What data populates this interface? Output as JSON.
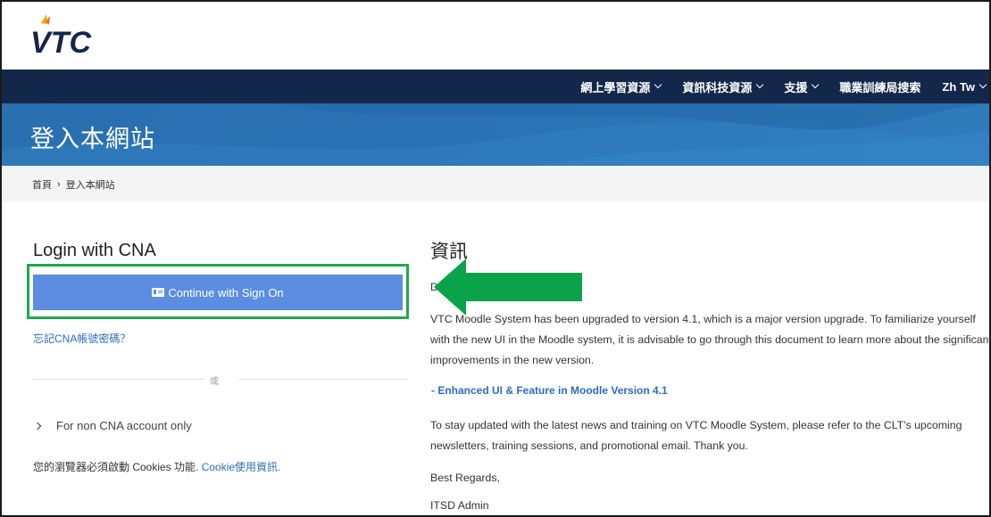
{
  "logo": {
    "text": "VTC"
  },
  "nav": {
    "items": [
      {
        "label": "網上學習資源",
        "has_dropdown": true
      },
      {
        "label": "資訊科技資源",
        "has_dropdown": true
      },
      {
        "label": "支援",
        "has_dropdown": true
      },
      {
        "label": "職業訓練局搜索",
        "has_dropdown": false
      },
      {
        "label": "Zh Tw",
        "has_dropdown": true
      }
    ]
  },
  "banner": {
    "title": "登入本網站"
  },
  "breadcrumb": {
    "home": "首頁",
    "separator": "›",
    "current": "登入本網站"
  },
  "login": {
    "title": "Login with CNA",
    "sso_button": "Continue with Sign On",
    "forgot_link": "忘記CNA帳號密碼？",
    "divider": "或",
    "non_cna": "For non CNA account only",
    "cookies_text": "您的瀏覽器必須啟動 Cookies 功能. ",
    "cookies_link": "Cookie使用資訊."
  },
  "info": {
    "title": "資訊",
    "greeting": "D",
    "paragraph1": "VTC Moodle System has been upgraded to version 4.1, which is a major version upgrade. To familiarize yourself with the new UI in the Moodle system, it is advisable to go through this document to learn more about the significant improvements in the new version.",
    "feature_link": "- Enhanced UI & Feature in Moodle Version 4.1",
    "paragraph2": "To stay updated with the latest news and training on VTC Moodle System, please refer to the CLT's upcoming newsletters, training sessions, and promotional email.  Thank you.",
    "regards": "Best Regards,",
    "signature": "ITSD Admin"
  },
  "colors": {
    "navbar": "#13274a",
    "banner": "#2a6fb0",
    "button": "#5b8ee0",
    "highlight_box": "#1faa4a",
    "arrow": "#0aa34a",
    "link": "#2b6cbf"
  },
  "icons": {
    "logo": "vtc-logo",
    "button": "id-card-icon",
    "dropdown": "chevron-down-icon",
    "expand": "chevron-right-icon",
    "annotation": "green-arrow"
  }
}
